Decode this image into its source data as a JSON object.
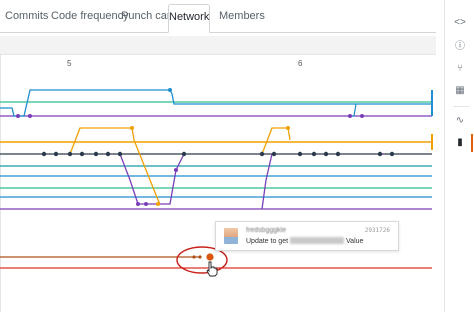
{
  "tabs": [
    {
      "label": "Commits",
      "selected": false
    },
    {
      "label": "Code frequency",
      "selected": false
    },
    {
      "label": "Punch card",
      "selected": false
    },
    {
      "label": "Network",
      "selected": true
    },
    {
      "label": "Members",
      "selected": false
    }
  ],
  "axis": {
    "labels": [
      "5",
      "6"
    ]
  },
  "tooltip": {
    "author": "fredsbgggkle",
    "sha": "2931726",
    "message_prefix": "Update to get",
    "message_suffix": "Value"
  },
  "sidebar": {
    "items": [
      {
        "icon": "code-icon",
        "glyph": "<>"
      },
      {
        "icon": "info-icon",
        "glyph": "ⓘ"
      },
      {
        "icon": "pull-request-icon",
        "glyph": "⑂"
      },
      {
        "icon": "project-icon",
        "glyph": "▦"
      },
      {
        "icon": "pulse-icon",
        "glyph": "∿"
      },
      {
        "icon": "graph-icon",
        "glyph": "▮"
      }
    ]
  },
  "colors": {
    "blue": "#1f8ece",
    "green": "#2ebf8f",
    "purple": "#7a3fb8",
    "orange": "#f0a000",
    "black": "#2b3a4a",
    "teal": "#189aa8",
    "brown": "#b0501a",
    "red": "#e0302a",
    "highlight": "#c8221c"
  }
}
